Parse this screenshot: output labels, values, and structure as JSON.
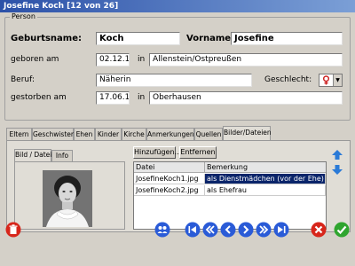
{
  "window": {
    "title": "Josefine Koch [12 von 26]"
  },
  "person": {
    "legend": "Person",
    "birthname_label": "Geburtsname:",
    "birthname_value": "Koch",
    "firstnames_label": "Vornamen:",
    "firstnames_value": "Josefine",
    "born_label": "geboren am",
    "born_date": "02.12.1897",
    "born_in_label": "in",
    "born_place": "Allenstein/Ostpreußen",
    "job_label": "Beruf:",
    "job_value": "Näherin",
    "gender_label": "Geschlecht:",
    "gender_value": "female",
    "died_label": "gestorben am",
    "died_date": "17.06.1971",
    "died_in_label": "in",
    "died_place": "Oberhausen"
  },
  "tabs": [
    {
      "label": "Eltern"
    },
    {
      "label": "Geschwister"
    },
    {
      "label": "Ehen"
    },
    {
      "label": "Kinder"
    },
    {
      "label": "Kirche"
    },
    {
      "label": "Anmerkungen"
    },
    {
      "label": "Quellen"
    },
    {
      "label": "Bilder/Dateien",
      "active": true
    }
  ],
  "subtabs": [
    {
      "label": "Bild / Datei",
      "active": true
    },
    {
      "label": "Info"
    }
  ],
  "buttons": {
    "add": "Hinzufügen...",
    "remove": "Entfernen"
  },
  "files": {
    "columns": [
      "Datei",
      "Bemerkung"
    ],
    "rows": [
      {
        "file": "JosefineKoch1.jpg",
        "note": "als Dienstmädchen (vor der Ehe)",
        "selected": true
      },
      {
        "file": "JosefineKoch2.jpg",
        "note": "als Ehefrau",
        "selected": false
      }
    ]
  },
  "colors": {
    "titlebar": "#2c51a8",
    "selection": "#0a246a",
    "nav_blue": "#2a5bd7",
    "delete_red": "#d7261b",
    "ok_green": "#2fa52f"
  }
}
